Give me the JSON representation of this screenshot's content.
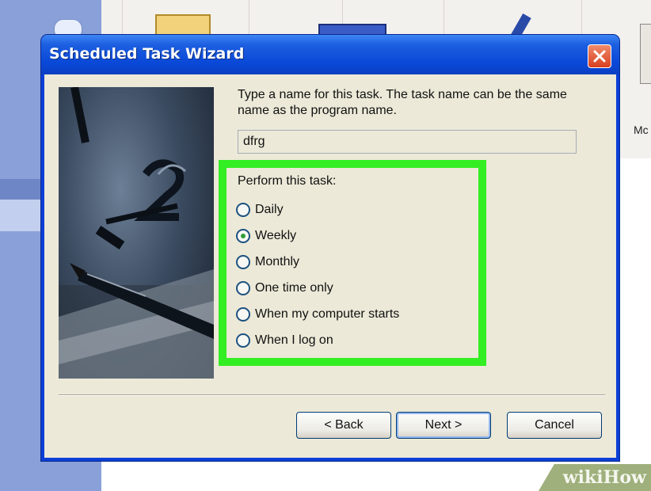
{
  "dialog": {
    "title": "Scheduled Task Wizard",
    "prompt": "Type a name for this task.  The task name can be the same name as the program name.",
    "task_name_value": "dfrg",
    "perform_label": "Perform this task:",
    "options": [
      {
        "label": "Daily",
        "checked": false
      },
      {
        "label": "Weekly",
        "checked": true
      },
      {
        "label": "Monthly",
        "checked": false
      },
      {
        "label": "One time only",
        "checked": false
      },
      {
        "label": "When my computer starts",
        "checked": false
      },
      {
        "label": "When I log on",
        "checked": false
      }
    ],
    "buttons": {
      "back": "< Back",
      "next": "Next >",
      "cancel": "Cancel"
    }
  },
  "background": {
    "partial_label": "Mc"
  },
  "watermark": "wikiHow",
  "colors": {
    "titlebar": "#0a49d8",
    "highlight": "#33ee22",
    "dialog_face": "#ece9d8"
  }
}
